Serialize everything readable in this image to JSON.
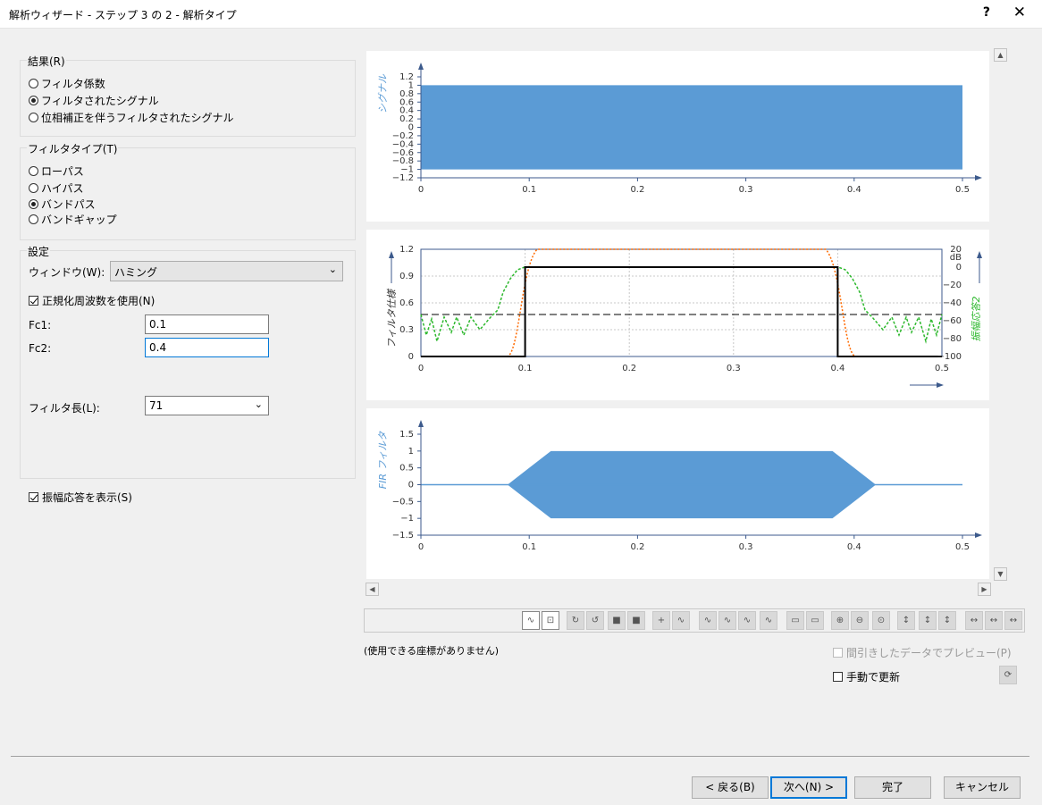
{
  "window": {
    "title": "解析ウィザード - ステップ 3 の 2 - 解析タイプ",
    "help": "?",
    "close": "✕"
  },
  "results_group": {
    "title": "結果(R)",
    "options": [
      "フィルタ係数",
      "フィルタされたシグナル",
      "位相補正を伴うフィルタされたシグナル"
    ],
    "selected": "フィルタされたシグナル"
  },
  "filter_type_group": {
    "title": "フィルタタイプ(T)",
    "options": [
      "ローパス",
      "ハイパス",
      "バンドパス",
      "バンドギャップ"
    ],
    "selected": "バンドパス"
  },
  "settings_group": {
    "title": "設定",
    "window_label": "ウィンドウ(W):",
    "window_value": "ハミング",
    "normalized_label": "正規化周波数を使用(N)",
    "normalized_checked": true,
    "fc1_label": "Fc1:",
    "fc1_value": "0.1",
    "fc2_label": "Fc2:",
    "fc2_value": "0.4",
    "length_label": "フィルタ長(L):",
    "length_value": "71"
  },
  "show_amplitude": {
    "label": "振幅応答を表示(S)",
    "checked": true
  },
  "plots": {
    "signal": {
      "ylabel": "シグナル",
      "yticks": [
        "1.2",
        "1",
        "0.8",
        "0.6",
        "0.4",
        "0.2",
        "0",
        "−0.2",
        "−0.4",
        "−0.6",
        "−0.8",
        "−1",
        "−1.2"
      ],
      "xticks": [
        "0",
        "0.1",
        "0.2",
        "0.3",
        "0.4",
        "0.5"
      ]
    },
    "filter": {
      "ylabel_left": "フィルタ仕様",
      "ylabel_right": "振幅応答2",
      "yticks_left": [
        "1.2",
        "0.9",
        "0.6",
        "0.3",
        "0"
      ],
      "yticks_right": [
        "20",
        "0",
        "−20",
        "−40",
        "−60",
        "−80",
        "−100"
      ],
      "unit_right": "dB",
      "xticks": [
        "0",
        "0.1",
        "0.2",
        "0.3",
        "0.4",
        "0.5"
      ]
    },
    "fir": {
      "ylabel": "FIR フィルタ",
      "yticks": [
        "1.5",
        "1",
        "0.5",
        "0",
        "−0.5",
        "−1",
        "−1.5"
      ],
      "xticks": [
        "0",
        "0.1",
        "0.2",
        "0.3",
        "0.4",
        "0.5"
      ]
    }
  },
  "colors": {
    "signal": "#5b9bd5",
    "spec": "#000000",
    "response": "#2db82d",
    "response2": "#ff6a00",
    "axis": "#3c5a8c"
  },
  "chart_data": [
    {
      "type": "area",
      "title": "",
      "ylabel": "シグナル",
      "xlim": [
        0,
        0.5
      ],
      "ylim": [
        -1.2,
        1.2
      ],
      "series": [
        {
          "x": [
            0,
            0.5
          ],
          "upper": [
            1,
            1
          ],
          "lower": [
            -1,
            -1
          ]
        }
      ]
    },
    {
      "type": "line",
      "title": "",
      "ylabel": "フィルタ仕様",
      "y2label": "振幅応答2",
      "xlim": [
        0,
        0.5
      ],
      "ylim": [
        0,
        1.2
      ],
      "y2lim": [
        -100,
        20
      ],
      "series": [
        {
          "x": [
            0,
            0.1,
            0.1,
            0.4,
            0.4,
            0.5
          ],
          "values": [
            0,
            0,
            1,
            1,
            0,
            0
          ]
        }
      ]
    },
    {
      "type": "area",
      "title": "",
      "ylabel": "FIR フィルタ",
      "xlim": [
        0,
        0.5
      ],
      "ylim": [
        -1.5,
        1.5
      ],
      "series": [
        {
          "x": [
            0,
            0.08,
            0.1,
            0.12,
            0.35,
            0.38,
            0.4,
            0.42,
            0.5
          ],
          "upper": [
            0,
            0,
            0.5,
            1,
            1,
            1,
            0.5,
            0,
            0
          ],
          "lower": [
            0,
            0,
            -0.5,
            -1,
            -1,
            -1,
            -0.5,
            0,
            0
          ]
        }
      ]
    }
  ],
  "toolbar": {
    "status_text": "(使用できる座標がありません)",
    "preview_label": "間引きしたデータでプレビュー(P)",
    "manual_update_label": "手動で更新"
  },
  "buttons": {
    "back": "< 戻る(B)",
    "next": "次へ(N) >",
    "finish": "完了",
    "cancel": "キャンセル"
  }
}
